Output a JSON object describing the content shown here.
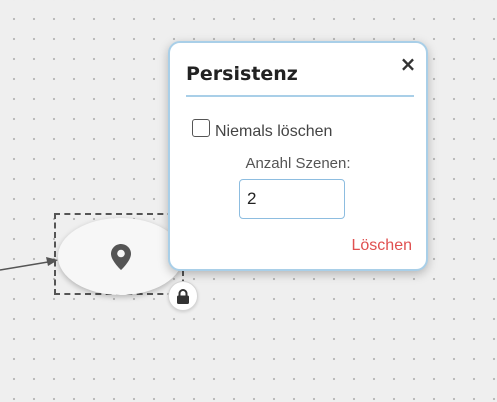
{
  "popup": {
    "title": "Persistenz",
    "close_label": "×",
    "never_delete_label": "Niemals löschen",
    "never_delete_checked": false,
    "scene_count_label": "Anzahl Szenen:",
    "scene_count_value": "2",
    "delete_label": "Löschen"
  },
  "node": {
    "icon": "map-pin-icon"
  },
  "colors": {
    "popup_border": "#a9cfe8",
    "delete_text": "#e05050",
    "canvas_bg": "#efefef"
  }
}
